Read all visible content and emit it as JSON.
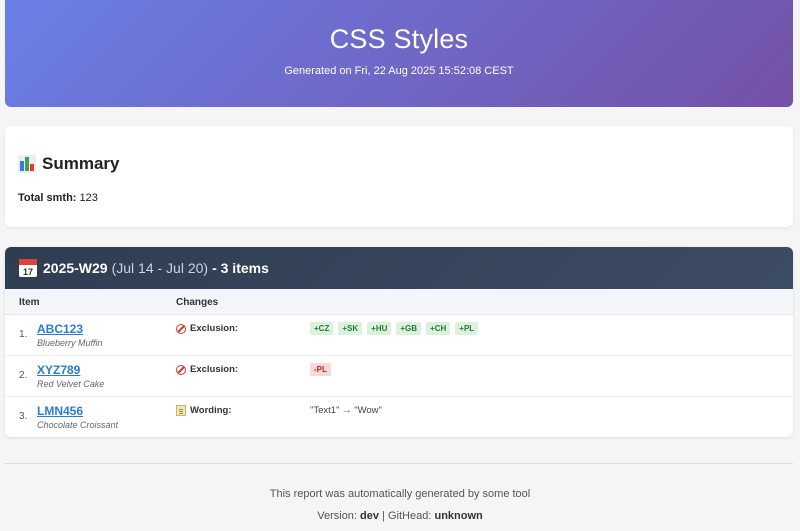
{
  "header": {
    "title": "CSS Styles",
    "generated": "Generated on Fri, 22 Aug 2025 15:52:08 CEST"
  },
  "summary": {
    "heading": "Summary",
    "total_label": "Total smth:",
    "total_value": "123",
    "icon": "bar-chart-icon"
  },
  "week": {
    "icon_day": "17",
    "id": "2025-W29",
    "range": "(Jul 14 - Jul 20)",
    "count": "- 3 items",
    "columns": {
      "item": "Item",
      "changes": "Changes"
    },
    "rows": [
      {
        "index": "1.",
        "code": "ABC123",
        "desc": "Blueberry Muffin",
        "change_type": "Exclusion:",
        "icon": "no-entry-icon",
        "badges": [
          "+CZ",
          "+SK",
          "+HU",
          "+GB",
          "+CH",
          "+PL"
        ]
      },
      {
        "index": "2.",
        "code": "XYZ789",
        "desc": "Red Velvet Cake",
        "change_type": "Exclusion:",
        "icon": "no-entry-icon",
        "badges": [
          "-PL"
        ]
      },
      {
        "index": "3.",
        "code": "LMN456",
        "desc": "Chocolate Croissant",
        "change_type": "Wording:",
        "icon": "memo-icon",
        "wording": "\"Text1\" → \"Wow\""
      }
    ]
  },
  "footer": {
    "line1": "This report was automatically generated by some tool",
    "version_label": "Version:",
    "version": "dev",
    "separator": "|",
    "githead_label": "GitHead:",
    "githead": "unknown"
  },
  "colors": {
    "header_gradient_start": "#6a7fe6",
    "header_gradient_end": "#7451a8",
    "week_header": "#2f3d52",
    "link": "#2a7bd0",
    "add_badge": "#dcf1dd",
    "remove_badge": "#f8d8d8"
  }
}
